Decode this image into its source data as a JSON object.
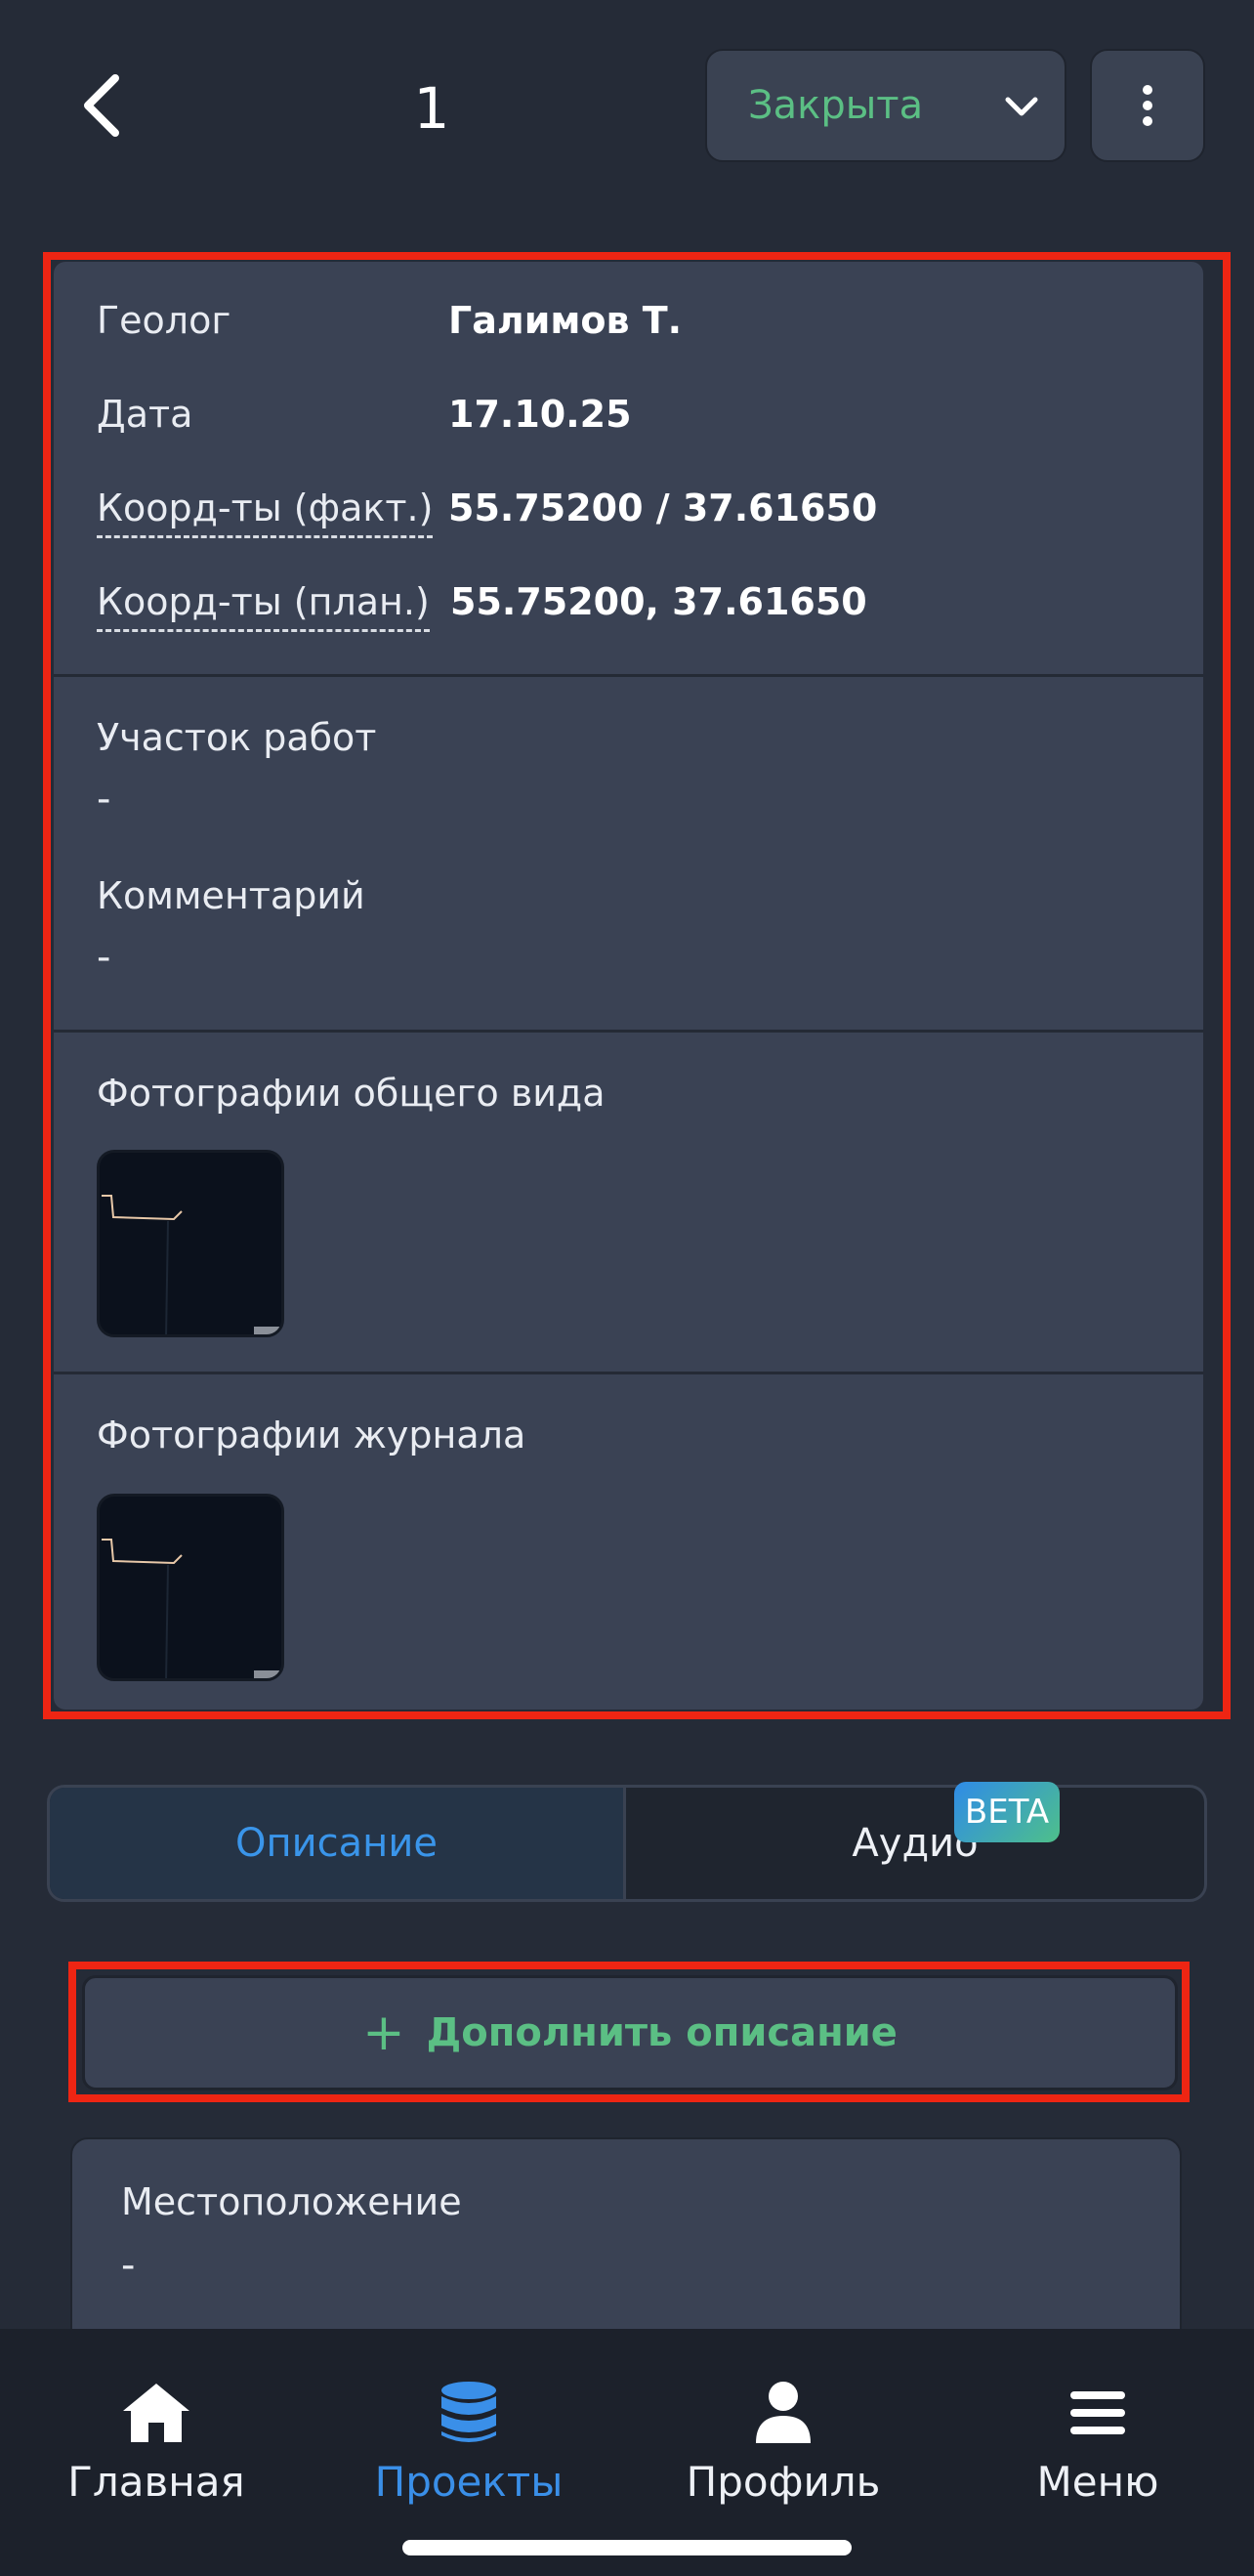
{
  "header": {
    "title": "1",
    "status": "Закрыта"
  },
  "info": {
    "geologist_label": "Геолог",
    "geologist_value": "Галимов Т.",
    "date_label": "Дата",
    "date_value": "17.10.25",
    "coords_fact_label": "Коорд-ты (факт.)",
    "coords_fact_value": "55.75200 / 37.61650",
    "coords_plan_label": "Коорд-ты (план.)",
    "coords_plan_value": "55.75200, 37.61650",
    "site_label": "Участок работ",
    "site_value": "-",
    "comment_label": "Комментарий",
    "comment_value": "-",
    "general_photos_label": "Фотографии общего вида",
    "journal_photos_label": "Фотографии журнала"
  },
  "tabs": {
    "description": "Описание",
    "audio": "Аудио",
    "beta": "BETA"
  },
  "add_description": "Дополнить описание",
  "location": {
    "label": "Местоположение",
    "value": "-"
  },
  "nav": {
    "home": "Главная",
    "projects": "Проекты",
    "profile": "Профиль",
    "menu": "Меню"
  },
  "colors": {
    "background": "#252b37",
    "card": "#3a4254",
    "accent_green": "#5bbf84",
    "accent_blue": "#3a8fe8",
    "highlight_red": "#ee2513"
  }
}
